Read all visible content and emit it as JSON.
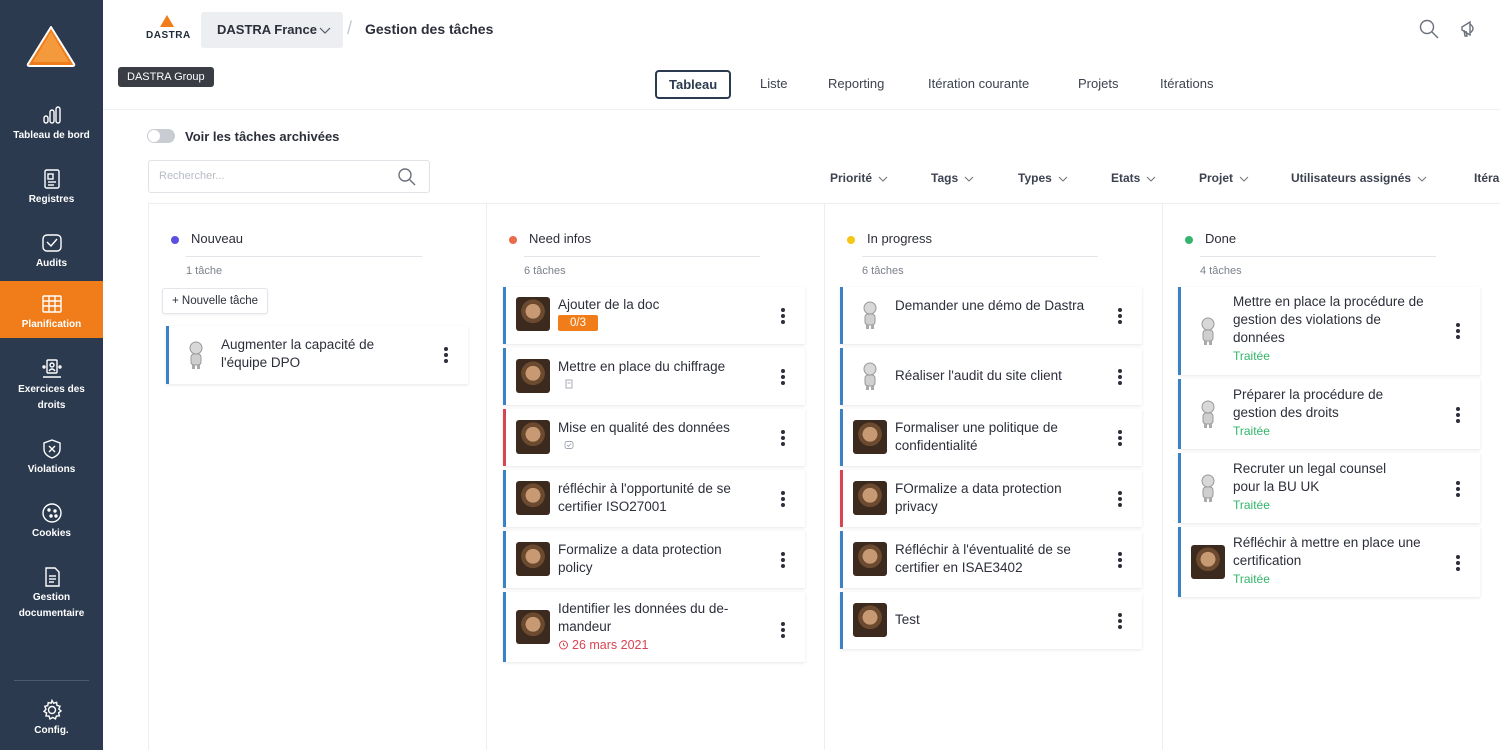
{
  "sidebar": {
    "items": [
      {
        "label": "Tableau de bord",
        "icon": "bar-chart-icon"
      },
      {
        "label": "Registres",
        "icon": "register-icon"
      },
      {
        "label": "Audits",
        "icon": "audit-icon"
      },
      {
        "label": "Planification",
        "icon": "planning-icon",
        "active": true
      },
      {
        "label": "Exercices des droits",
        "icon": "rights-icon"
      },
      {
        "label": "Violations",
        "icon": "shield-icon"
      },
      {
        "label": "Cookies",
        "icon": "cookie-icon"
      },
      {
        "label": "Gestion documentaire",
        "icon": "document-icon"
      },
      {
        "label": "Config.",
        "icon": "gear-icon"
      }
    ]
  },
  "header": {
    "brand": "DASTRA",
    "org": "DASTRA France",
    "breadcrumb": "Gestion des tâches",
    "tooltip": "DASTRA Group"
  },
  "tabs": [
    "Tableau",
    "Liste",
    "Reporting",
    "Itération courante",
    "Projets",
    "Itérations"
  ],
  "archive_toggle": "Voir les tâches archivées",
  "search": {
    "placeholder": "Rechercher...",
    "value": ""
  },
  "filters": [
    "Priorité",
    "Tags",
    "Types",
    "Etats",
    "Projet",
    "Utilisateurs assignés",
    "Itéra"
  ],
  "colors": {
    "accent": "#f07d1a",
    "sidebar": "#2b3a4e",
    "done": "#33b56b",
    "late": "#d94452"
  },
  "columns": [
    {
      "name": "Nouveau",
      "count": "1 tâche",
      "dot": "#5b4fe0",
      "add_label": "+ Nouvelle tâche",
      "cards": [
        {
          "title": "Augmenter la capacité de l'équipe DPO"
        }
      ]
    },
    {
      "name": "Need infos",
      "count": "6 tâches",
      "dot": "#ec6a4c",
      "cards": [
        {
          "title": "Ajouter de la doc",
          "badge": "0/3"
        },
        {
          "title": "Mettre en place du chiffrage"
        },
        {
          "title": "Mise en qualité des données"
        },
        {
          "title": "réfléchir à l'opportunité de se certifier ISO27001"
        },
        {
          "title": "Formalize a data protection policy"
        },
        {
          "title": "Identifier les données du de-mandeur",
          "due": "26 mars 2021"
        }
      ]
    },
    {
      "name": "In progress",
      "count": "6 tâches",
      "dot": "#f5c518",
      "cards": [
        {
          "title": "Demander une démo de Dastra"
        },
        {
          "title": "Réaliser l'audit du site client"
        },
        {
          "title": "Formaliser une politique de confidentialité"
        },
        {
          "title": "FOrmalize a data protection privacy"
        },
        {
          "title": "Réfléchir à l'éventualité de se certifier en ISAE3402"
        },
        {
          "title": "Test"
        }
      ]
    },
    {
      "name": "Done",
      "count": "4 tâches",
      "dot": "#33b56b",
      "cards": [
        {
          "title": "Mettre en place la procédure de gestion des violations de données",
          "status": "Traitée"
        },
        {
          "title": "Préparer la procédure de gestion des droits",
          "status": "Traitée"
        },
        {
          "title": "Recruter un legal counsel pour la BU UK",
          "status": "Traitée"
        },
        {
          "title": "Réfléchir à mettre en place une certification",
          "status": "Traitée"
        }
      ]
    }
  ]
}
